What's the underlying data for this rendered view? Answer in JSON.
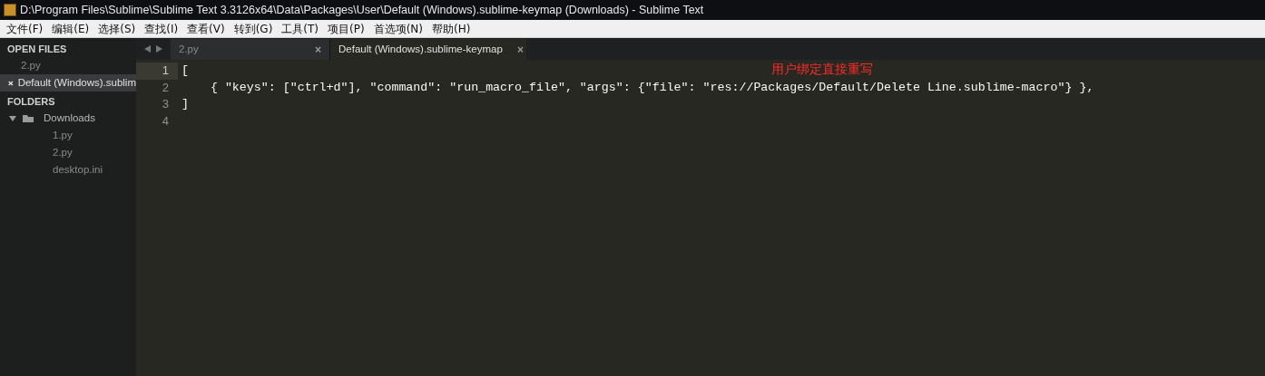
{
  "window": {
    "title": "D:\\Program Files\\Sublime\\Sublime Text 3.3126x64\\Data\\Packages\\User\\Default (Windows).sublime-keymap (Downloads) - Sublime Text"
  },
  "menu": [
    "文件(F)",
    "编辑(E)",
    "选择(S)",
    "查找(I)",
    "查看(V)",
    "转到(G)",
    "工具(T)",
    "项目(P)",
    "首选项(N)",
    "帮助(H)"
  ],
  "sidebar": {
    "open_files_title": "OPEN FILES",
    "open_files": [
      {
        "label": "2.py",
        "selected": false
      },
      {
        "label": "Default (Windows).sublim",
        "selected": true
      }
    ],
    "folders_title": "FOLDERS",
    "folders": [
      {
        "label": "Downloads",
        "expanded": true,
        "children": [
          {
            "label": "1.py"
          },
          {
            "label": "2.py"
          },
          {
            "label": "desktop.ini"
          }
        ]
      }
    ]
  },
  "tabs": [
    {
      "label": "2.py",
      "selected": false,
      "close": "×"
    },
    {
      "label": "Default (Windows).sublime-keymap",
      "selected": true,
      "close": "×"
    }
  ],
  "editor": {
    "lines": [
      {
        "number": "1",
        "text": "[",
        "current": true
      },
      {
        "number": "2",
        "text": "    { \"keys\": [\"ctrl+d\"], \"command\": \"run_macro_file\", \"args\": {\"file\": \"res://Packages/Default/Delete Line.sublime-macro\"} },",
        "current": false
      },
      {
        "number": "3",
        "text": "]",
        "current": false
      },
      {
        "number": "4",
        "current": false
      }
    ],
    "annotation": "用户绑定直接重写"
  }
}
